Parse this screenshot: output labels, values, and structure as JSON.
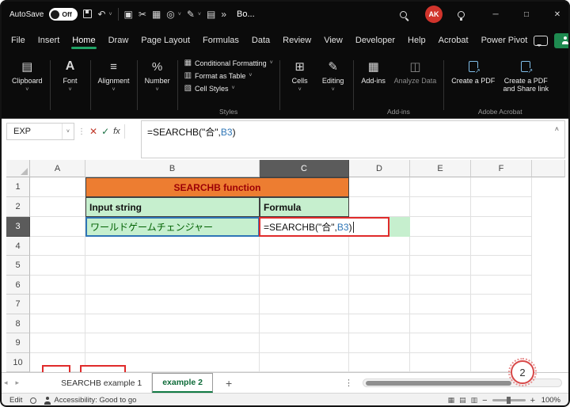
{
  "titlebar": {
    "autosave_label": "AutoSave",
    "autosave_state": "Off",
    "workbook_title": "Bo...",
    "avatar": "AK"
  },
  "menubar": {
    "items": [
      "File",
      "Insert",
      "Home",
      "Draw",
      "Page Layout",
      "Formulas",
      "Data",
      "Review",
      "View",
      "Developer",
      "Help",
      "Acrobat",
      "Power Pivot"
    ],
    "active_item": "Home"
  },
  "ribbon": {
    "clipboard": "Clipboard",
    "font": "Font",
    "alignment": "Alignment",
    "number": "Number",
    "styles_items": [
      "Conditional Formatting",
      "Format as Table",
      "Cell Styles"
    ],
    "styles_label": "Styles",
    "cells": "Cells",
    "editing": "Editing",
    "addins_button": "Add-ins",
    "analyze_data": "Analyze Data",
    "addins_label": "Add-ins",
    "create_pdf": "Create a PDF",
    "create_pdf_share": "Create a PDF and Share link",
    "acrobat_label": "Adobe Acrobat"
  },
  "formula_bar": {
    "name_box_value": "EXP",
    "cancel": "✕",
    "enter": "✓",
    "insert_function": "fx",
    "collapse": "˄"
  },
  "formula": {
    "prefix": "=SEARCHB(\"合\",",
    "ref": "B3",
    "suffix": ")"
  },
  "grid": {
    "columns": [
      "A",
      "B",
      "C",
      "D",
      "E",
      "F"
    ],
    "rows": [
      "1",
      "2",
      "3",
      "4",
      "5",
      "6",
      "7",
      "8",
      "9",
      "10"
    ],
    "selected_column": "C",
    "selected_row": "3",
    "cells": {
      "title": "SEARCHB function",
      "input_header": "Input string",
      "formula_header": "Formula",
      "input_value": "ワールドゲームチェンジャー"
    }
  },
  "sheet_tabs": {
    "tabs": [
      "SEARCHB example 1",
      "example 2"
    ],
    "active_tab": "example 2",
    "add_button": "+"
  },
  "status_bar": {
    "mode": "Edit",
    "accessibility": "Accessibility: Good to go",
    "zoom_level": "100%"
  },
  "annotation": {
    "badge": "2"
  },
  "colors": {
    "accent_green": "#21A366",
    "header_orange": "#ED7D31",
    "header_text": "#9C0006",
    "cell_green": "#C6EFCE",
    "cell_green_text": "#006100",
    "ref_blue": "#2E75B6",
    "annotation_red": "#E02B2B"
  }
}
